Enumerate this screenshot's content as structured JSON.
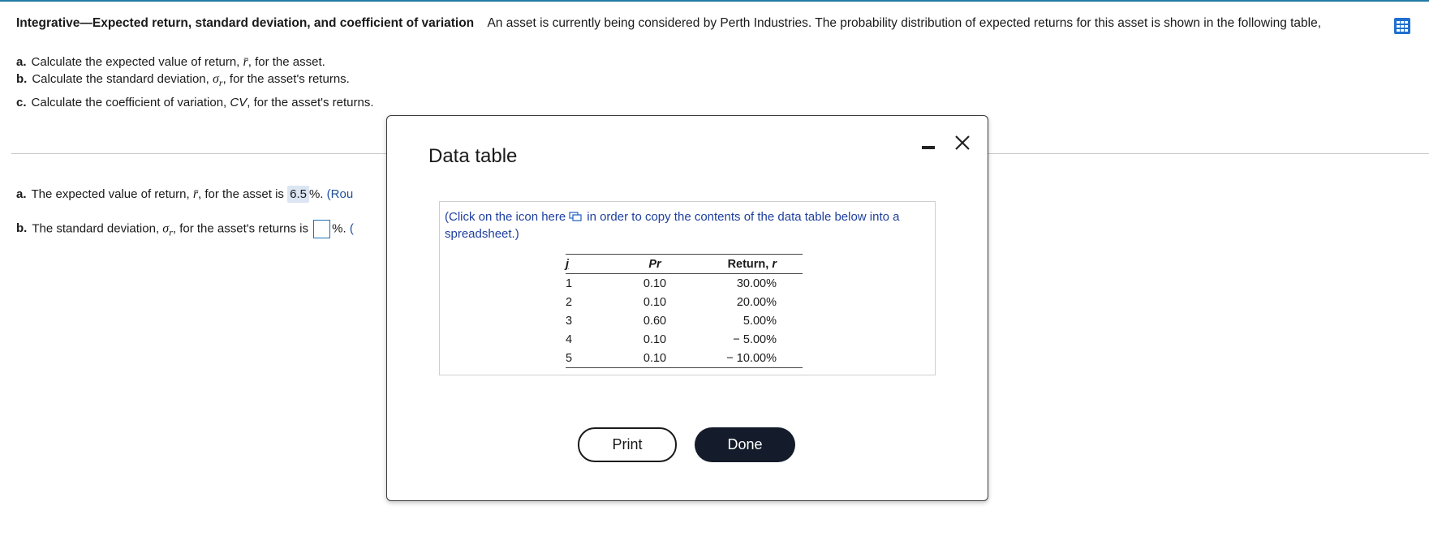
{
  "header": {
    "title": "Integrative—Expected return, standard deviation, and coefficient of variation",
    "intro": "An asset is currently being considered by Perth Industries.  The probability distribution of expected returns for this asset is shown in the following table,",
    "trailing": "."
  },
  "questions": {
    "a": {
      "letter": "a.",
      "text_before": "Calculate the expected value of return,",
      "symbol": "r̄",
      "text_after": ", for the asset."
    },
    "b": {
      "letter": "b.",
      "text_before": "Calculate the standard deviation,",
      "symbol": "σ",
      "subscript": "r",
      "text_after": ", for the asset's returns."
    },
    "c": {
      "letter": "c.",
      "text_before": "Calculate the coefficient of variation,",
      "symbol": "CV",
      "text_after": ", for the asset's returns."
    }
  },
  "answers": {
    "a": {
      "letter": "a.",
      "text_before": "The expected value of return,",
      "symbol": "r̄",
      "text_mid": ", for the asset is",
      "value": "6.5",
      "unit": "%.",
      "hint": "(Rou"
    },
    "b": {
      "letter": "b.",
      "text_before": "The standard deviation,",
      "symbol": "σ",
      "subscript": "r",
      "text_mid": ", for the asset's returns is",
      "value": "",
      "unit": "%.",
      "hint": "("
    }
  },
  "modal": {
    "title": "Data table",
    "copy_note_before": "(Click on the icon here",
    "copy_note_after": "in order to copy the contents of the data table below into a spreadsheet.)",
    "table": {
      "headers": [
        "j",
        "Pr",
        "Return, ",
        "r"
      ],
      "rows": [
        [
          "1",
          "0.10",
          "30.00%"
        ],
        [
          "2",
          "0.10",
          "20.00%"
        ],
        [
          "3",
          "0.60",
          "5.00%"
        ],
        [
          "4",
          "0.10",
          "− 5.00%"
        ],
        [
          "5",
          "0.10",
          "− 10.00%"
        ]
      ]
    },
    "print_label": "Print",
    "done_label": "Done"
  },
  "colors": {
    "accent": "#1f7aa6",
    "link": "#1f3f9e",
    "done_bg": "#141c2b",
    "input_fill": "#dbe6f2"
  }
}
